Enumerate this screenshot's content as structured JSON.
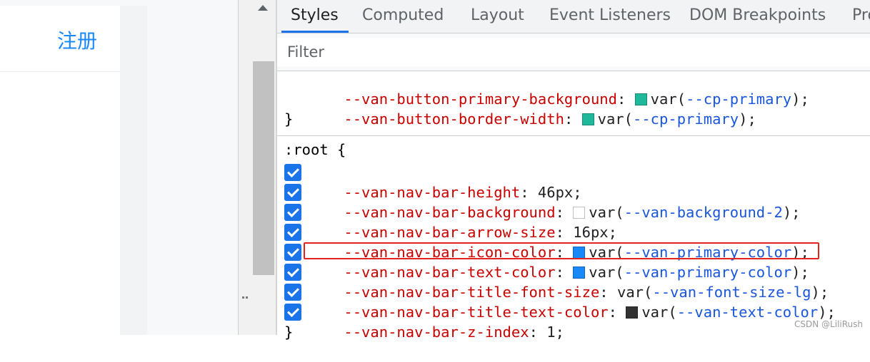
{
  "app": {
    "register_label": "注册"
  },
  "devtools": {
    "tabs": [
      "Styles",
      "Computed",
      "Layout",
      "Event Listeners",
      "DOM Breakpoints",
      "Pro"
    ],
    "active_tab": "Styles",
    "filter_placeholder": "Filter",
    "prev_rule": {
      "decls": [
        {
          "prop": "--van-button-primary-background",
          "colon": ": ",
          "swatch": "#1fb89a",
          "value_prefix": "var(",
          "ref": "--cp-primary",
          "value_suffix": ");"
        },
        {
          "prop": "--van-button-border-width",
          "colon": ": ",
          "swatch": "#1fb89a",
          "value_prefix": "var(",
          "ref": "--cp-primary",
          "value_suffix": ");"
        }
      ],
      "close_brace": "}"
    },
    "root_rule": {
      "selector": ":root {",
      "close_brace": "}",
      "decls": [
        {
          "prop": "--van-nav-bar-height",
          "colon": ": ",
          "value_prefix": "46px;",
          "checked": true
        },
        {
          "prop": "--van-nav-bar-background",
          "colon": ": ",
          "swatch": "#ffffff",
          "value_prefix": "var(",
          "ref": "--van-background-2",
          "value_suffix": ");",
          "checked": true
        },
        {
          "prop": "--van-nav-bar-arrow-size",
          "colon": ": ",
          "value_prefix": "16px;",
          "checked": true
        },
        {
          "prop": "--van-nav-bar-icon-color",
          "colon": ": ",
          "swatch": "#1989fa",
          "value_prefix": "var(",
          "ref": "--van-primary-color",
          "value_suffix": ");",
          "checked": true
        },
        {
          "prop": "--van-nav-bar-text-color",
          "colon": ": ",
          "swatch": "#1989fa",
          "value_prefix": "var(",
          "ref": "--van-primary-color",
          "value_suffix": ");",
          "checked": true
        },
        {
          "prop": "--van-nav-bar-title-font-size",
          "colon": ": ",
          "value_prefix": "var(",
          "ref": "--van-font-size-lg",
          "value_suffix": ");",
          "checked": true
        },
        {
          "prop": "--van-nav-bar-title-text-color",
          "colon": ": ",
          "swatch": "#323233",
          "value_prefix": "var(",
          "ref": "--van-text-color",
          "value_suffix": ");",
          "checked": true
        },
        {
          "prop": "--van-nav-bar-z-index",
          "colon": ": ",
          "value_prefix": "1;",
          "checked": true
        }
      ]
    }
  },
  "watermark": "CSDN @LiliRush",
  "colors": {
    "accent": "#1a73e8",
    "highlight_box": "#e3231d",
    "property": "#c80000",
    "variable_ref": "#1a56db"
  }
}
